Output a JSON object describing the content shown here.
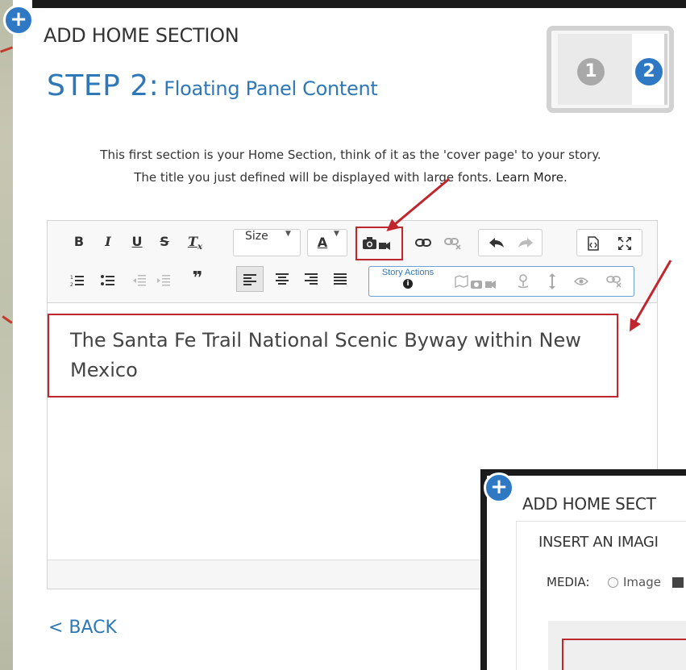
{
  "dialog": {
    "header_title": "ADD HOME SECTION",
    "step_label": "STEP 2:",
    "step_subtitle": "Floating Panel Content",
    "stepper": {
      "step1": "1",
      "step2": "2",
      "active_step": 2
    },
    "intro_line1": "This first section is your Home Section, think of it as the 'cover page' to your story.",
    "intro_line2": "The title you just defined will be displayed with large fonts.",
    "learn_more": "Learn More",
    "intro_end": ".",
    "back_link": "< BACK"
  },
  "toolbar": {
    "bold": "B",
    "italic": "I",
    "underline": "U",
    "strike": "S",
    "clear_format": "T",
    "size_label": "Size",
    "font_color": "A",
    "story_actions": "Story Actions",
    "info": "i"
  },
  "editor": {
    "content": "The Santa Fe Trail National Scenic Byway within New Mexico"
  },
  "inset_dialog": {
    "title": "ADD HOME SECT",
    "insert_label": "INSERT AN IMAGI",
    "media_label": "MEDIA:",
    "image_option": "Image"
  },
  "colors": {
    "accent_blue": "#2e78b7",
    "highlight_red": "#c0262d",
    "arrow_red": "#c0262d"
  }
}
